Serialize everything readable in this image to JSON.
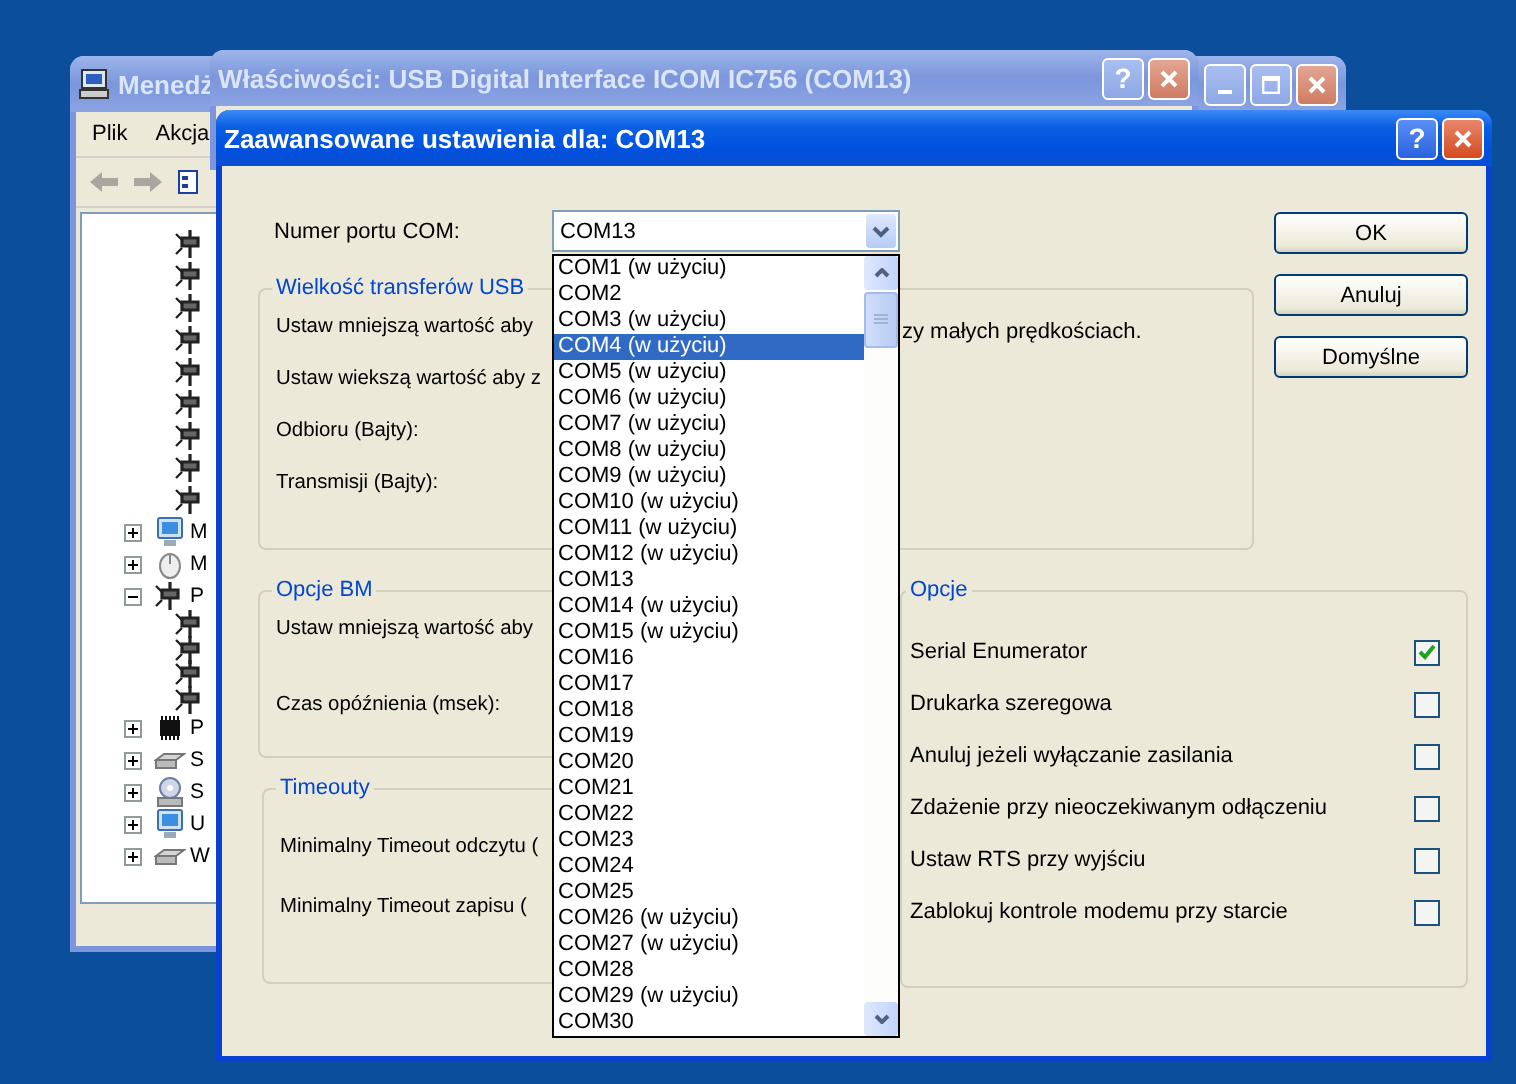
{
  "device_manager": {
    "title": "Menedż",
    "menu": [
      "Plik",
      "Akcja"
    ],
    "tree": [
      {
        "kind": "port"
      },
      {
        "kind": "port"
      },
      {
        "kind": "port"
      },
      {
        "kind": "port"
      },
      {
        "kind": "port"
      },
      {
        "kind": "port"
      },
      {
        "kind": "port"
      },
      {
        "kind": "port"
      },
      {
        "kind": "port"
      },
      {
        "kind": "monitor",
        "label": "M",
        "expanded": false
      },
      {
        "kind": "mouse",
        "label": "M",
        "expanded": false
      },
      {
        "kind": "port",
        "label": "P",
        "expanded": true,
        "children": [
          {
            "kind": "port"
          },
          {
            "kind": "port"
          },
          {
            "kind": "port"
          },
          {
            "kind": "port"
          }
        ]
      },
      {
        "kind": "chip",
        "label": "P",
        "expanded": false
      },
      {
        "kind": "drive",
        "label": "S",
        "expanded": false
      },
      {
        "kind": "disc",
        "label": "S",
        "expanded": false
      },
      {
        "kind": "monitor",
        "label": "U",
        "expanded": false
      },
      {
        "kind": "drive",
        "label": "W",
        "expanded": false
      }
    ]
  },
  "properties_window": {
    "title": "Właściwości: USB Digital Interface ICOM IC756 (COM13)",
    "help_button": "?"
  },
  "dialog": {
    "title": "Zaawansowane ustawienia dla: COM13",
    "help_button": "?",
    "port_label": "Numer portu COM:",
    "port_value": "COM13",
    "port_options": [
      {
        "label": "COM1 (w użyciu)",
        "selected": false
      },
      {
        "label": "COM2",
        "selected": false
      },
      {
        "label": "COM3 (w użyciu)",
        "selected": false
      },
      {
        "label": "COM4 (w użyciu)",
        "selected": true
      },
      {
        "label": "COM5 (w użyciu)",
        "selected": false
      },
      {
        "label": "COM6 (w użyciu)",
        "selected": false
      },
      {
        "label": "COM7 (w użyciu)",
        "selected": false
      },
      {
        "label": "COM8 (w użyciu)",
        "selected": false
      },
      {
        "label": "COM9 (w użyciu)",
        "selected": false
      },
      {
        "label": "COM10 (w użyciu)",
        "selected": false
      },
      {
        "label": "COM11 (w użyciu)",
        "selected": false
      },
      {
        "label": "COM12 (w użyciu)",
        "selected": false
      },
      {
        "label": "COM13",
        "selected": false
      },
      {
        "label": "COM14 (w użyciu)",
        "selected": false
      },
      {
        "label": "COM15 (w użyciu)",
        "selected": false
      },
      {
        "label": "COM16",
        "selected": false
      },
      {
        "label": "COM17",
        "selected": false
      },
      {
        "label": "COM18",
        "selected": false
      },
      {
        "label": "COM19",
        "selected": false
      },
      {
        "label": "COM20",
        "selected": false
      },
      {
        "label": "COM21",
        "selected": false
      },
      {
        "label": "COM22",
        "selected": false
      },
      {
        "label": "COM23",
        "selected": false
      },
      {
        "label": "COM24",
        "selected": false
      },
      {
        "label": "COM25",
        "selected": false
      },
      {
        "label": "COM26 (w użyciu)",
        "selected": false
      },
      {
        "label": "COM27 (w użyciu)",
        "selected": false
      },
      {
        "label": "COM28",
        "selected": false
      },
      {
        "label": "COM29 (w użyciu)",
        "selected": false
      },
      {
        "label": "COM30",
        "selected": false
      }
    ],
    "buttons": [
      "OK",
      "Anuluj",
      "Domyślne"
    ],
    "usb_group": {
      "legend": "Wielkość transferów USB",
      "lines": [
        "Ustaw mniejszą wartość aby",
        "Ustaw wiekszą wartość aby z",
        "Odbioru (Bajty):",
        "Transmisji (Bajty):"
      ],
      "first_line_tail": "zy małych prędkościach."
    },
    "bm_group": {
      "legend": "Opcje BM",
      "lines": [
        "Ustaw mniejszą wartość aby",
        "Czas opóźnienia (msek):"
      ]
    },
    "timeouts_group": {
      "legend": "Timeouty",
      "lines": [
        "Minimalny Timeout odczytu (",
        "Minimalny Timeout zapisu ("
      ]
    },
    "options_group": {
      "legend": "Opcje",
      "items": [
        {
          "label": "Serial Enumerator",
          "checked": true
        },
        {
          "label": "Drukarka szeregowa",
          "checked": false
        },
        {
          "label": "Anuluj jeżeli wyłączanie zasilania",
          "checked": false
        },
        {
          "label": "Zdażenie przy nieoczekiwanym odłączeniu",
          "checked": false
        },
        {
          "label": "Ustaw RTS przy wyjściu",
          "checked": false
        },
        {
          "label": "Zablokuj kontrole modemu przy starcie",
          "checked": false
        }
      ]
    }
  }
}
